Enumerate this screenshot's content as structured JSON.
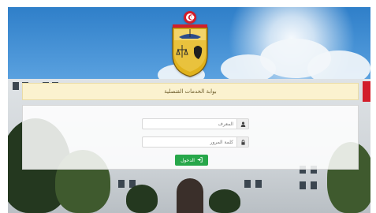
{
  "header": {
    "title": "بوابة الخدمات القنصلية"
  },
  "login": {
    "username_placeholder": "المعرف",
    "password_placeholder": "كلمة المرور",
    "submit_label": "الدخول"
  },
  "icons": {
    "username": "user-icon",
    "password": "lock-icon",
    "submit": "sign-in-icon"
  },
  "colors": {
    "banner_background": "#fbf2cf",
    "submit_button": "#27a74a",
    "flag": "#d21e2a"
  }
}
